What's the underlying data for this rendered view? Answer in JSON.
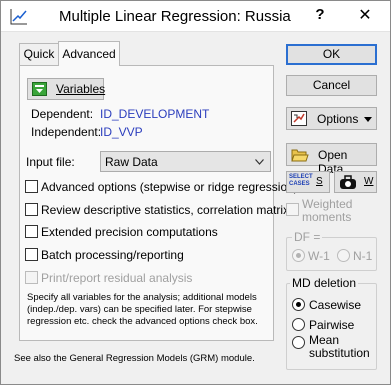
{
  "window": {
    "title": "Multiple Linear Regression: Russia",
    "help_label": "?",
    "close_label": "✕"
  },
  "tabs": [
    {
      "label": "Quick"
    },
    {
      "label": "Advanced"
    }
  ],
  "panel": {
    "variables_button": "Variables",
    "dependent_label": "Dependent:",
    "dependent_value": "ID_DEVELOPMENT",
    "independent_label": "Independent:",
    "independent_value": "ID_VVP",
    "input_file_label": "Input file:",
    "input_file_value": "Raw Data",
    "options": [
      {
        "label": "Advanced options (stepwise or ridge regression)",
        "checked": false,
        "enabled": true
      },
      {
        "label": "Review descriptive statistics, correlation matrix",
        "checked": false,
        "enabled": true
      },
      {
        "label": "Extended precision computations",
        "checked": false,
        "enabled": true
      },
      {
        "label": "Batch processing/reporting",
        "checked": false,
        "enabled": true
      },
      {
        "label": "Print/report residual analysis",
        "checked": false,
        "enabled": false
      }
    ],
    "note": "Specify all variables for the analysis; additional models (indep./dep. vars) can be specified later.  For stepwise regression etc. check the advanced options check box."
  },
  "footer": {
    "text": "See also the General Regression Models (GRM) module."
  },
  "right": {
    "ok": "OK",
    "cancel": "Cancel",
    "options": "Options",
    "open_data": "Open Data",
    "select_cases_icon_text": "SELECT CASES",
    "select_cases_shortcut": "S",
    "weights_shortcut": "W",
    "weighted_moments": "Weighted moments",
    "df_title": "DF =",
    "df_options": [
      "W-1",
      "N-1"
    ],
    "md_title": "MD deletion",
    "md_options": [
      "Casewise",
      "Pairwise",
      "Mean substitution"
    ]
  },
  "colors": {
    "accent_blue": "#2b3dbd",
    "ok_border": "#2b6fd1"
  }
}
